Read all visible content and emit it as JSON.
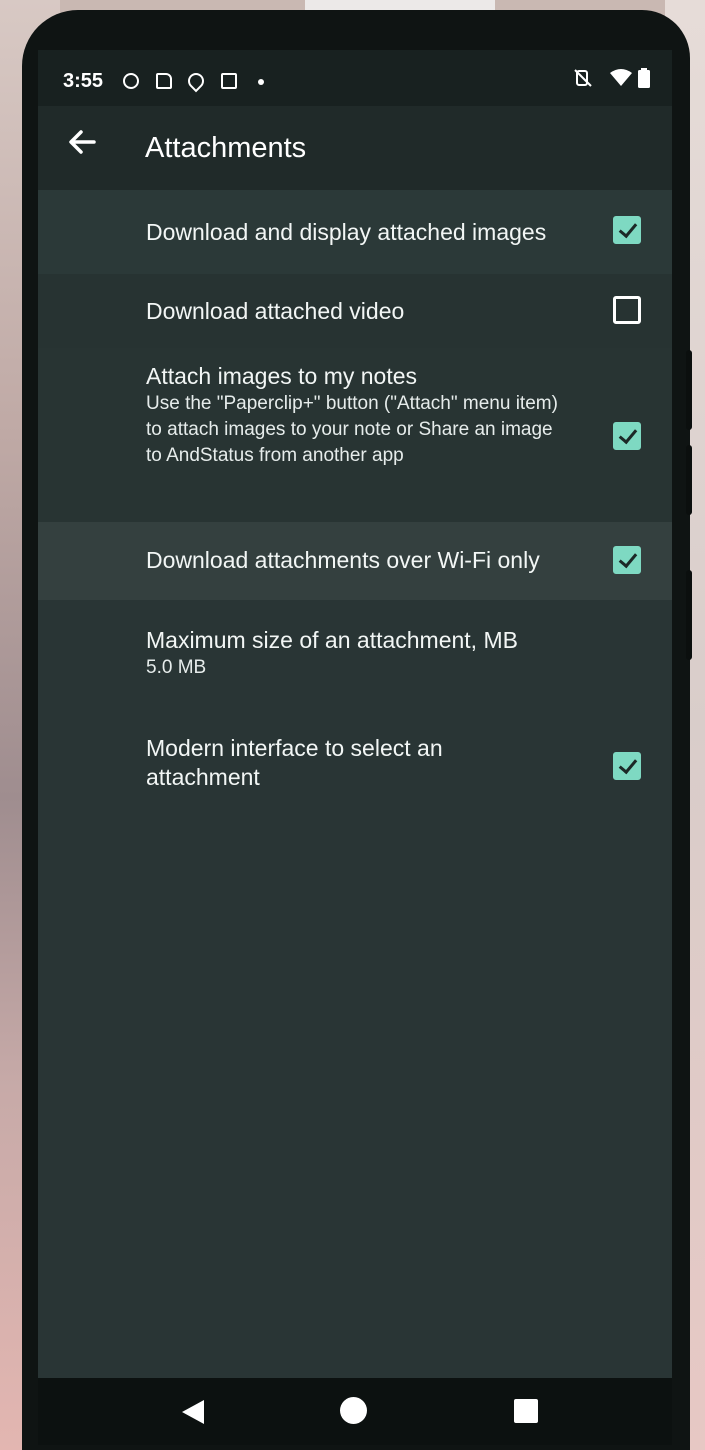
{
  "status_bar": {
    "time": "3:55",
    "left_icons": [
      "app-notification-icon",
      "sim-card-icon",
      "location-icon",
      "shopping-bag-icon",
      "dot-icon"
    ],
    "right_icons": [
      "mute-vibrate-icon",
      "wifi-icon",
      "battery-icon"
    ]
  },
  "app_bar": {
    "back_icon": "back-arrow-icon",
    "title": "Attachments"
  },
  "preferences": [
    {
      "title": "Download and display attached images",
      "summary": "",
      "checked": true
    },
    {
      "title": "Download attached video",
      "summary": "",
      "checked": false
    },
    {
      "title": "Attach images to my notes",
      "summary": "Use the \"Paperclip+\" button (\"Attach\" menu item) to attach images to your note or Share an image to AndStatus from another app",
      "checked": true
    },
    {
      "title": "Download attachments over Wi-Fi only",
      "summary": "",
      "checked": true
    },
    {
      "title": "Maximum size of an attachment, MB",
      "summary": "5.0 MB",
      "checked": null
    },
    {
      "title": "Modern interface to select an attachment",
      "summary": "",
      "checked": true
    }
  ],
  "nav_bar": {
    "icons": [
      "nav-back-icon",
      "nav-home-icon",
      "nav-recents-icon"
    ]
  },
  "colors": {
    "accent": "#7ed9c2",
    "background": "#293535",
    "app_bar": "#202a29"
  }
}
